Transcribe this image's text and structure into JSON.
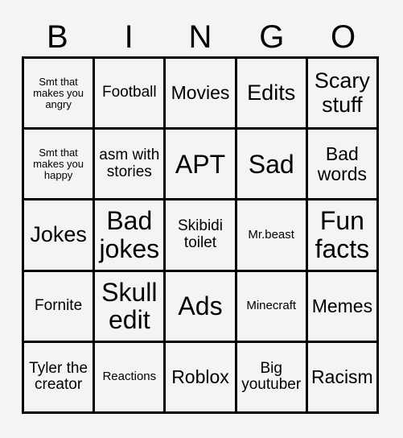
{
  "header": {
    "letters": [
      "B",
      "I",
      "N",
      "G",
      "O"
    ]
  },
  "grid": {
    "rows": [
      [
        {
          "text": "Smt that makes you angry",
          "size": "fs-xs"
        },
        {
          "text": "Football",
          "size": "fs-md"
        },
        {
          "text": "Movies",
          "size": "fs-lg"
        },
        {
          "text": "Edits",
          "size": "fs-xl"
        },
        {
          "text": "Scary stuff",
          "size": "fs-xl"
        }
      ],
      [
        {
          "text": "Smt that makes you happy",
          "size": "fs-xs"
        },
        {
          "text": "asm with stories",
          "size": "fs-md"
        },
        {
          "text": "APT",
          "size": "fs-xxl"
        },
        {
          "text": "Sad",
          "size": "fs-xxl"
        },
        {
          "text": "Bad words",
          "size": "fs-lg"
        }
      ],
      [
        {
          "text": "Jokes",
          "size": "fs-xl"
        },
        {
          "text": "Bad jokes",
          "size": "fs-xxl"
        },
        {
          "text": "Skibidi toilet",
          "size": "fs-md"
        },
        {
          "text": "Mr.beast",
          "size": "fs-sm"
        },
        {
          "text": "Fun facts",
          "size": "fs-xxl"
        }
      ],
      [
        {
          "text": "Fornite",
          "size": "fs-md"
        },
        {
          "text": "Skull edit",
          "size": "fs-xxl"
        },
        {
          "text": "Ads",
          "size": "fs-xxl"
        },
        {
          "text": "Minecraft",
          "size": "fs-sm"
        },
        {
          "text": "Memes",
          "size": "fs-lg"
        }
      ],
      [
        {
          "text": "Tyler the creator",
          "size": "fs-md"
        },
        {
          "text": "Reactions",
          "size": "fs-sm"
        },
        {
          "text": "Roblox",
          "size": "fs-lg"
        },
        {
          "text": "Big youtuber",
          "size": "fs-md"
        },
        {
          "text": "Racism",
          "size": "fs-lg"
        }
      ]
    ]
  },
  "colors": {
    "background": "#f4f4f4",
    "grid_line": "#000000",
    "text": "#000000"
  }
}
